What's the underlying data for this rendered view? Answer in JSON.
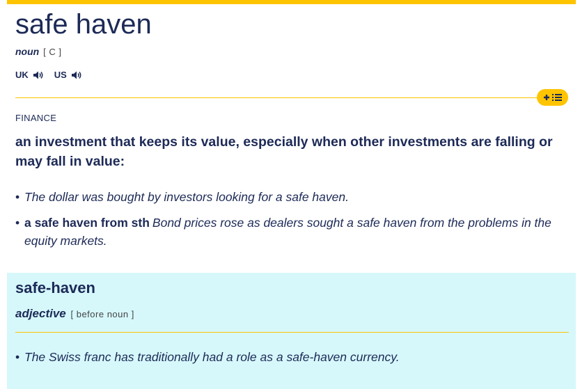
{
  "entry": {
    "headword": "safe haven",
    "pos": "noun",
    "grammar": "[ C ]",
    "pronunciation": [
      {
        "label": "UK",
        "icon": "speaker-icon"
      },
      {
        "label": "US",
        "icon": "speaker-icon"
      }
    ],
    "add_to_list_icons": [
      "plus-icon",
      "list-icon"
    ],
    "domain": "FINANCE",
    "definition": "an investment that keeps its value, especially when other investments are falling or may fall in value:",
    "examples": [
      {
        "bullet": "•",
        "collocation": "",
        "text": "The dollar was bought by investors looking for a safe haven."
      },
      {
        "bullet": "•",
        "collocation": "a safe haven from sth",
        "text": "Bond prices rose as dealers sought a safe haven from the problems in the equity markets."
      }
    ]
  },
  "related": {
    "headword": "safe-haven",
    "pos": "adjective",
    "grammar": "[ before noun ]",
    "example_bullet": "•",
    "example": "The Swiss franc has traditionally had a role as a safe-haven currency."
  },
  "colors": {
    "accent": "#fec400",
    "text": "#1d2a57",
    "panel": "#d6f8fb"
  }
}
